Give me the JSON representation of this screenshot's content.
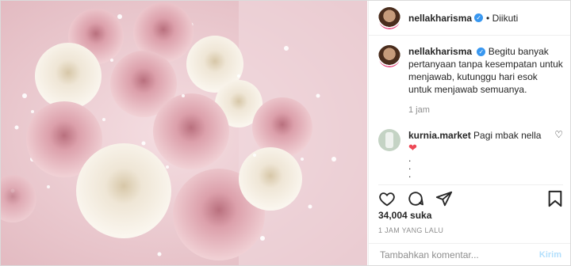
{
  "post": {
    "username": "nellakharisma",
    "follow_state": "• Diikuti",
    "caption": "Begitu banyak pertanyaan tanpa kesempatan untuk menjawab, kutunggu hari esok untuk menjawab semuanya.",
    "caption_time": "1 jam",
    "likes": "34,004 suka",
    "time_ago": "1 JAM YANG LALU"
  },
  "comment": {
    "username": "kurnia.market",
    "text": "Pagi mbak nella",
    "heart": "❤",
    "dot1": ".",
    "dot2": ".",
    "dot3": "."
  },
  "add_comment": {
    "placeholder": "Tambahkan komentar...",
    "post_label": "Kirim"
  },
  "icons": {
    "verified": "verified-badge-icon",
    "like": "heart-icon",
    "comment": "comment-icon",
    "share": "share-icon",
    "save": "bookmark-icon"
  },
  "colors": {
    "verified": "#3897f0",
    "heart": "#ed4956",
    "post_button": "#b2dffc"
  }
}
